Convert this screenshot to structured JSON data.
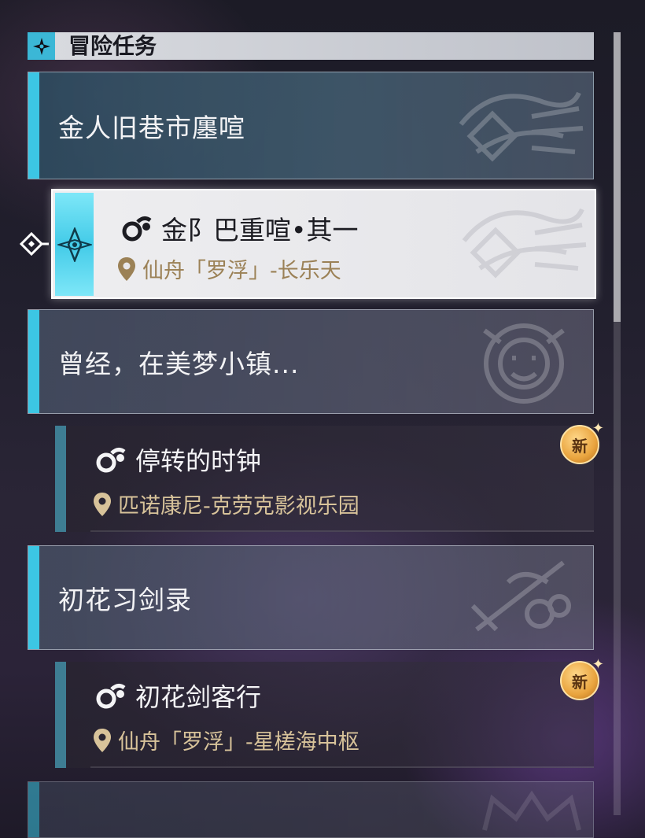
{
  "header": {
    "title": "冒险任务",
    "icon": "four-point-star-icon"
  },
  "groups": [
    {
      "label": "金人旧巷市廛喧"
    },
    {
      "label": "曾经，在美梦小镇..."
    },
    {
      "label": "初花习剑录"
    },
    {
      "label": ""
    }
  ],
  "quests": [
    {
      "title": "金阝巴重喧•其一",
      "location": "仙舟「罗浮」-长乐天",
      "selected": true,
      "new": false
    },
    {
      "title": "停转的时钟",
      "location": "匹诺康尼-克劳克影视乐园",
      "selected": false,
      "new": true
    },
    {
      "title": "初花剑客行",
      "location": "仙舟「罗浮」-星槎海中枢",
      "selected": false,
      "new": true
    }
  ],
  "badge": {
    "new_label": "新"
  },
  "colors": {
    "accent": "#3cc6e4",
    "location": "#d8c39a",
    "badge": "#e9a43e"
  }
}
